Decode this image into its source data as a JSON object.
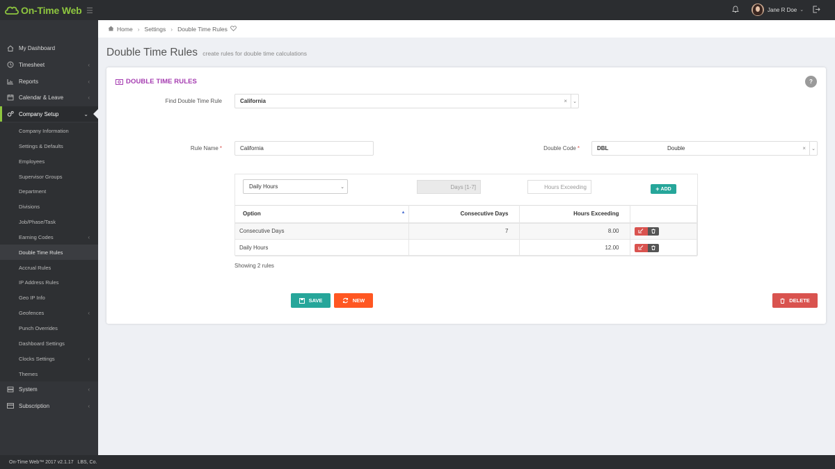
{
  "app": {
    "name": "On-Time Web",
    "footer": "On-Time Web™ 2017 v2.1.17   LBS, Co."
  },
  "user": {
    "name": "Jane R Doe"
  },
  "colors": {
    "accent": "#8ec63f",
    "title": "#a43bb0",
    "teal": "#26a69a",
    "orange": "#ff5722",
    "red": "#d9534f"
  },
  "sidebar": {
    "items": [
      {
        "label": "My Dashboard",
        "icon": "home-icon"
      },
      {
        "label": "Timesheet",
        "icon": "clock-icon"
      },
      {
        "label": "Reports",
        "icon": "bar-chart-icon"
      },
      {
        "label": "Calendar & Leave",
        "icon": "calendar-icon"
      },
      {
        "label": "Company Setup",
        "icon": "cogs-icon"
      }
    ],
    "sub_items": [
      {
        "label": "Company Information"
      },
      {
        "label": "Settings & Defaults"
      },
      {
        "label": "Employees"
      },
      {
        "label": "Supervisor Groups"
      },
      {
        "label": "Department"
      },
      {
        "label": "Divisions"
      },
      {
        "label": "Job/Phase/Task"
      },
      {
        "label": "Earning Codes"
      },
      {
        "label": "Double Time Rules"
      },
      {
        "label": "Accrual Rules"
      },
      {
        "label": "IP Address Rules"
      },
      {
        "label": "Geo IP Info"
      },
      {
        "label": "Geofences"
      },
      {
        "label": "Punch Overrides"
      },
      {
        "label": "Dashboard Settings"
      },
      {
        "label": "Clocks Settings"
      },
      {
        "label": "Themes"
      }
    ],
    "bottom_items": [
      {
        "label": "System",
        "icon": "server-icon"
      },
      {
        "label": "Subscription",
        "icon": "credit-card-icon"
      }
    ]
  },
  "breadcrumb": {
    "home": "Home",
    "settings": "Settings",
    "current": "Double Time Rules"
  },
  "page": {
    "title": "Double Time Rules",
    "subtitle": "create rules for double time calculations"
  },
  "card": {
    "title": "DOUBLE TIME RULES",
    "help": "?",
    "find_label": "Find Double Time Rule",
    "find_value": "California",
    "rule_name_label": "Rule Name",
    "rule_name_value": "California",
    "double_code_label": "Double Code",
    "double_code_value": "DBL",
    "double_code_desc": "Double",
    "req": "*"
  },
  "editor": {
    "option_select": "Daily Hours",
    "days_placeholder": "Days [1-7]",
    "hours_placeholder": "Hours Exceeding",
    "add_label": "ADD"
  },
  "table": {
    "headers": {
      "option": "Option",
      "days": "Consecutive Days",
      "hours": "Hours Exceeding"
    },
    "rows": [
      {
        "option": "Consecutive Days",
        "days": "7",
        "hours": "8.00"
      },
      {
        "option": "Daily Hours",
        "days": "",
        "hours": "12.00"
      }
    ],
    "showing": "Showing 2 rules"
  },
  "buttons": {
    "save": "SAVE",
    "new": "NEW",
    "delete": "DELETE"
  }
}
